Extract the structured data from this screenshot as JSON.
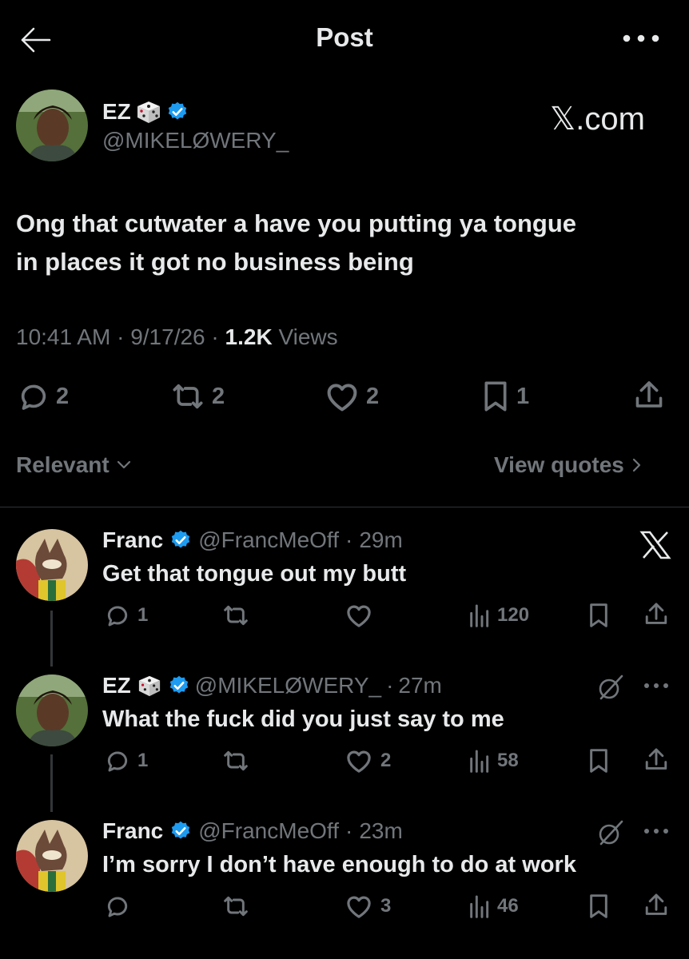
{
  "header": {
    "title": "Post"
  },
  "post": {
    "author_name": "EZ",
    "handle": "@MIKELØWERY_",
    "watermark": "𝕏.com",
    "text_line1": "Ong that cutwater a have you putting ya tongue",
    "text_line2": "in places it got no business being",
    "time": "10:41 AM",
    "date": "9/17/26",
    "views_count": "1.2K",
    "views_label": "Views",
    "replies": "2",
    "reposts": "2",
    "likes": "2",
    "bookmarks": "1"
  },
  "filter": {
    "relevant_label": "Relevant",
    "view_quotes_label": "View quotes"
  },
  "replies": [
    {
      "name": "Franc",
      "handle": "@FrancMeOff",
      "time": "29m",
      "text": "Get that tongue out my butt",
      "replies": "1",
      "reposts": "",
      "likes": "",
      "views": "120"
    },
    {
      "name": "EZ",
      "handle": "@MIKELØWERY_",
      "time": "27m",
      "text": "What the fuck did you just say to me",
      "replies": "1",
      "reposts": "",
      "likes": "2",
      "views": "58"
    },
    {
      "name": "Franc",
      "handle": "@FrancMeOff",
      "time": "23m",
      "text": "I’m sorry I don’t have enough to do at work",
      "replies": "",
      "reposts": "",
      "likes": "3",
      "views": "46"
    }
  ],
  "separator": "·",
  "colors": {
    "background": "#000000",
    "text": "#e7e9ea",
    "secondary": "#71767b",
    "verified": "#1d9bf0",
    "divider": "#2f3336"
  }
}
